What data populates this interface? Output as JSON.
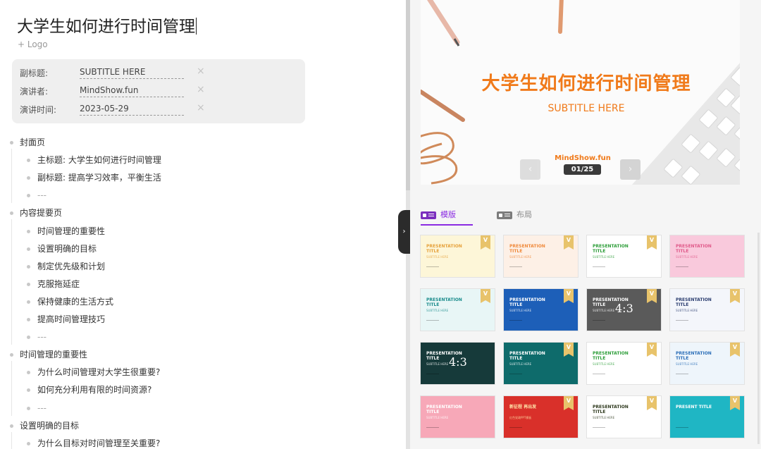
{
  "editor": {
    "title": "大学生如何进行时间管理",
    "add_logo": "+ Logo",
    "meta": [
      {
        "label": "副标题:",
        "value": "SUBTITLE HERE",
        "clear": "×"
      },
      {
        "label": "演讲者:",
        "value": "MindShow.fun",
        "clear": "×"
      },
      {
        "label": "演讲时间:",
        "value": "2023-05-29",
        "clear": "×"
      }
    ],
    "outline": [
      {
        "level": 1,
        "text": "封面页"
      },
      {
        "level": 2,
        "text": "主标题: 大学生如何进行时间管理"
      },
      {
        "level": 2,
        "text": "副标题: 提高学习效率，平衡生活"
      },
      {
        "level": 2,
        "text": "---"
      },
      {
        "level": 1,
        "text": "内容提要页"
      },
      {
        "level": 2,
        "text": "时间管理的重要性"
      },
      {
        "level": 2,
        "text": "设置明确的目标"
      },
      {
        "level": 2,
        "text": "制定优先级和计划"
      },
      {
        "level": 2,
        "text": "克服拖延症"
      },
      {
        "level": 2,
        "text": "保持健康的生活方式"
      },
      {
        "level": 2,
        "text": "提高时间管理技巧"
      },
      {
        "level": 2,
        "text": "---"
      },
      {
        "level": 1,
        "text": "时间管理的重要性"
      },
      {
        "level": 2,
        "text": "为什么时间管理对大学生很重要?"
      },
      {
        "level": 2,
        "text": "如何充分利用有限的时间资源?"
      },
      {
        "level": 2,
        "text": "---"
      },
      {
        "level": 1,
        "text": "设置明确的目标"
      },
      {
        "level": 2,
        "text": "为什么目标对时间管理至关重要?"
      }
    ]
  },
  "preview": {
    "slide_title": "大学生如何进行时间管理",
    "slide_subtitle": "SUBTITLE HERE",
    "brand": "MindShow.fun",
    "counter": "01/25",
    "prev": "‹",
    "next": "›",
    "collapse": "›"
  },
  "tabs": [
    {
      "label": "模版",
      "active": true
    },
    {
      "label": "布局",
      "active": false
    }
  ],
  "templates": [
    {
      "name": "cartoon-monster",
      "bg": "#fdf6d8",
      "accent": "#e6a23c",
      "title": "PRESENTATION TITLE",
      "sub": "SUBTITLE HERE",
      "badge": "V"
    },
    {
      "name": "orange-finance",
      "bg": "#fdf0e6",
      "accent": "#f08a3c",
      "title": "PRESENTATION TITLE",
      "sub": "SUBTITLE HERE",
      "badge": "V"
    },
    {
      "name": "green-arrow",
      "bg": "#ffffff",
      "accent": "#2e9e3a",
      "title": "PRESENTATION TITLE",
      "sub": "SUBTITLE HERE",
      "badge": "V"
    },
    {
      "name": "pink-bunny",
      "bg": "#f9c9dc",
      "accent": "#e05a8a",
      "title": "PRESENTATION TITLE",
      "sub": "SUBTITLE HERE",
      "badge": ""
    },
    {
      "name": "teal-umbrella",
      "bg": "#e8f6f6",
      "accent": "#1a8c8c",
      "title": "PRESENTATION TITLE",
      "sub": "SUBTITLE HERE",
      "badge": "V"
    },
    {
      "name": "blue-chart",
      "bg": "#1d5fb8",
      "accent": "#ffffff",
      "title": "PRESENTATION TITLE",
      "sub": "SUBTITLE HERE",
      "badge": "V"
    },
    {
      "name": "dark-43-a",
      "bg": "#5a5a5a",
      "accent": "#ffffff",
      "title": "PRESENTATION TITLE",
      "sub": "SUBTITLE HERE",
      "badge": "V",
      "big": "4:3"
    },
    {
      "name": "science-flask",
      "bg": "#f4f6fb",
      "accent": "#2c3e70",
      "title": "PRESENTATION TITLE",
      "sub": "SUBTITLE HERE",
      "badge": "V"
    },
    {
      "name": "dark-43-b",
      "bg": "#163a3a",
      "accent": "#ffffff",
      "title": "PRESENTATION TITLE",
      "sub": "SUBTITLE HERE",
      "badge": "",
      "big": "4:3"
    },
    {
      "name": "teal-city",
      "bg": "#0e6b6b",
      "accent": "#ffffff",
      "title": "PRESENTATION TITLE",
      "sub": "SUBTITLE HERE",
      "badge": "V"
    },
    {
      "name": "green-classroom",
      "bg": "#ffffff",
      "accent": "#2e9e3a",
      "title": "PRESENTATION TITLE",
      "sub": "SUBTITLE HERE",
      "badge": "V"
    },
    {
      "name": "blue-students",
      "bg": "#eef5fb",
      "accent": "#2c6fb8",
      "title": "PRESENTATION TITLE",
      "sub": "SUBTITLE HERE",
      "badge": "V"
    },
    {
      "name": "pink-running",
      "bg": "#f7a8b8",
      "accent": "#ffffff",
      "title": "PRESENTATION TITLE",
      "sub": "SUBTITLE HERE",
      "badge": ""
    },
    {
      "name": "red-new-journey",
      "bg": "#d9302a",
      "accent": "#ffe2a8",
      "title": "新征程 再出发",
      "sub": "红色党政PPT模板",
      "badge": "V"
    },
    {
      "name": "chevron-olive",
      "bg": "#ffffff",
      "accent": "#2f3a1e",
      "title": "PRESENTATION TITLE",
      "sub": "SUBTITLE HERE",
      "badge": "V"
    },
    {
      "name": "cyan-doctor",
      "bg": "#1fb6c4",
      "accent": "#ffffff",
      "title": "PRESENT TITLE",
      "sub": "",
      "badge": "V"
    }
  ]
}
